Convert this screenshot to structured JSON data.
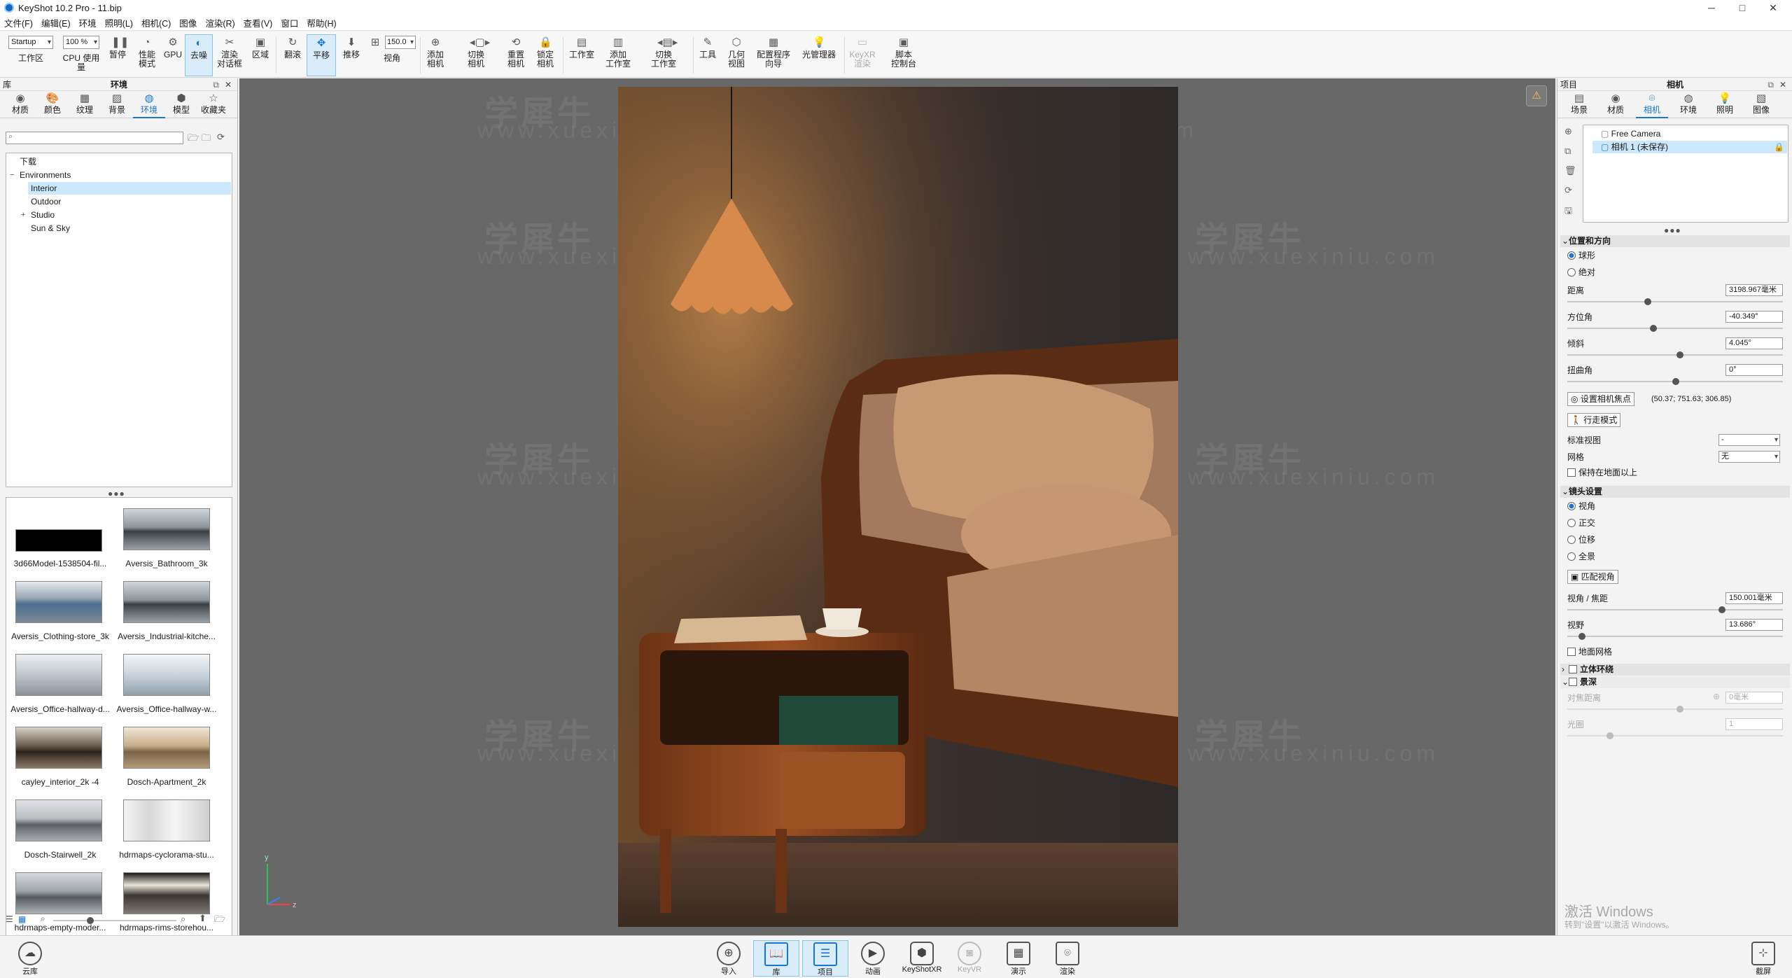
{
  "title": "KeyShot 10.2 Pro  - 11.bip",
  "window_controls": {
    "minimize": "─",
    "maximize": "□",
    "close": "✕"
  },
  "menu": [
    "文件(F)",
    "编辑(E)",
    "环境",
    "照明(L)",
    "相机(C)",
    "图像",
    "渲染(R)",
    "查看(V)",
    "窗口",
    "帮助(H)"
  ],
  "toolbar": {
    "workspace_select": "Startup",
    "workspace_label": "工作区",
    "zoom_select": "100 %",
    "cpu_label": "CPU 使用量",
    "pause_label": "暂停",
    "perf_label": "性能\n模式",
    "gpu_label": "GPU",
    "denoise_label": "去噪",
    "render_label": "渲染\n对话框",
    "region_label": "区域",
    "tumble_label": "翻滚",
    "pan_label": "平移",
    "dolly_label": "推移",
    "fov_value": "150.0",
    "fov_label": "视角",
    "add_camera_label": "添加\n相机",
    "switch_camera_label": "切换\n相机",
    "reset_camera_label": "重置\n相机",
    "lock_camera_label": "锁定\n相机",
    "studio_label": "工作室",
    "add_studio_label": "添加\n工作室",
    "switch_studio_label": "切换\n工作室",
    "tools_label": "工具",
    "geometry_view_label": "几何\n视图",
    "config_wizard_label": "配置程序\n向导",
    "light_manager_label": "光管理器",
    "ks_xr_label": "KeyXR\n渲染",
    "script_label": "脚本\n控制台"
  },
  "left": {
    "header_left": "库",
    "header_title": "环境",
    "tabs": [
      "材质",
      "颜色",
      "纹理",
      "背景",
      "环境",
      "模型",
      "收藏夹"
    ],
    "search_placeholder": "",
    "tree": [
      "下载",
      "Environments",
      "Interior",
      "Outdoor",
      "Studio",
      "Sun & Sky"
    ],
    "thumbs": [
      "3d66Model-1538504-fil...",
      "Aversis_Bathroom_3k",
      "Aversis_Clothing-store_3k",
      "Aversis_Industrial-kitche...",
      "Aversis_Office-hallway-d...",
      "Aversis_Office-hallway-w...",
      "cayley_interior_2k -4",
      "Dosch-Apartment_2k",
      "Dosch-Stairwell_2k",
      "hdrmaps-cyclorama-stu...",
      "hdrmaps-empty-moder...",
      "hdrmaps-rims-storehou..."
    ]
  },
  "viewport": {
    "watermark_cn": "学犀牛",
    "watermark_url": "www.xuexiniu.com",
    "axis_y": "y",
    "axis_z": "z"
  },
  "right": {
    "header_left": "项目",
    "header_title": "相机",
    "tabs": [
      "场景",
      "材质",
      "相机",
      "环境",
      "照明",
      "图像"
    ],
    "camera_list": [
      "Free Camera",
      "相机 1 (未保存)"
    ],
    "sec_position": "位置和方向",
    "radio_spherical": "球形",
    "radio_absolute": "绝对",
    "distance_label": "距离",
    "distance_value": "3198.967毫米",
    "azimuth_label": "方位角",
    "azimuth_value": "-40.349°",
    "inclination_label": "倾斜",
    "inclination_value": "4.045°",
    "twist_label": "扭曲角",
    "twist_value": "0°",
    "set_focus_btn": "设置相机焦点",
    "focus_coords": "(50.37; 751.63; 306.85)",
    "walk_mode_btn": "行走模式",
    "std_view_label": "标准视图",
    "std_view_value": "-",
    "grid_label": "网格",
    "grid_value": "无",
    "keep_above_ground": "保持在地面以上",
    "sec_lens": "镜头设置",
    "lens_perspective": "视角",
    "lens_ortho": "正交",
    "lens_shift": "位移",
    "lens_panorama": "全景",
    "match_persp_btn": "匹配视角",
    "fov_focal_label": "视角 / 焦距",
    "fov_focal_value": "150.001毫米",
    "fov_label": "视野",
    "fov_value": "13.686°",
    "ground_grid": "地面网格",
    "stereo": "立体环绕",
    "dof": "景深",
    "focus_dist_label": "对焦距离",
    "focus_dist_value": "0毫米",
    "aperture_label": "光圈",
    "aperture_value": "1",
    "activate_windows": "激活 Windows",
    "activate_sub": "转到\"设置\"以激活 Windows。"
  },
  "bottom": {
    "cloud": "云库",
    "import": "导入",
    "library": "库",
    "project": "项目",
    "animation": "动画",
    "keyshotxr": "KeyShotXR",
    "keyvr": "KeyVR",
    "presentation": "演示",
    "render": "渲染",
    "screenshot": "截屏"
  }
}
